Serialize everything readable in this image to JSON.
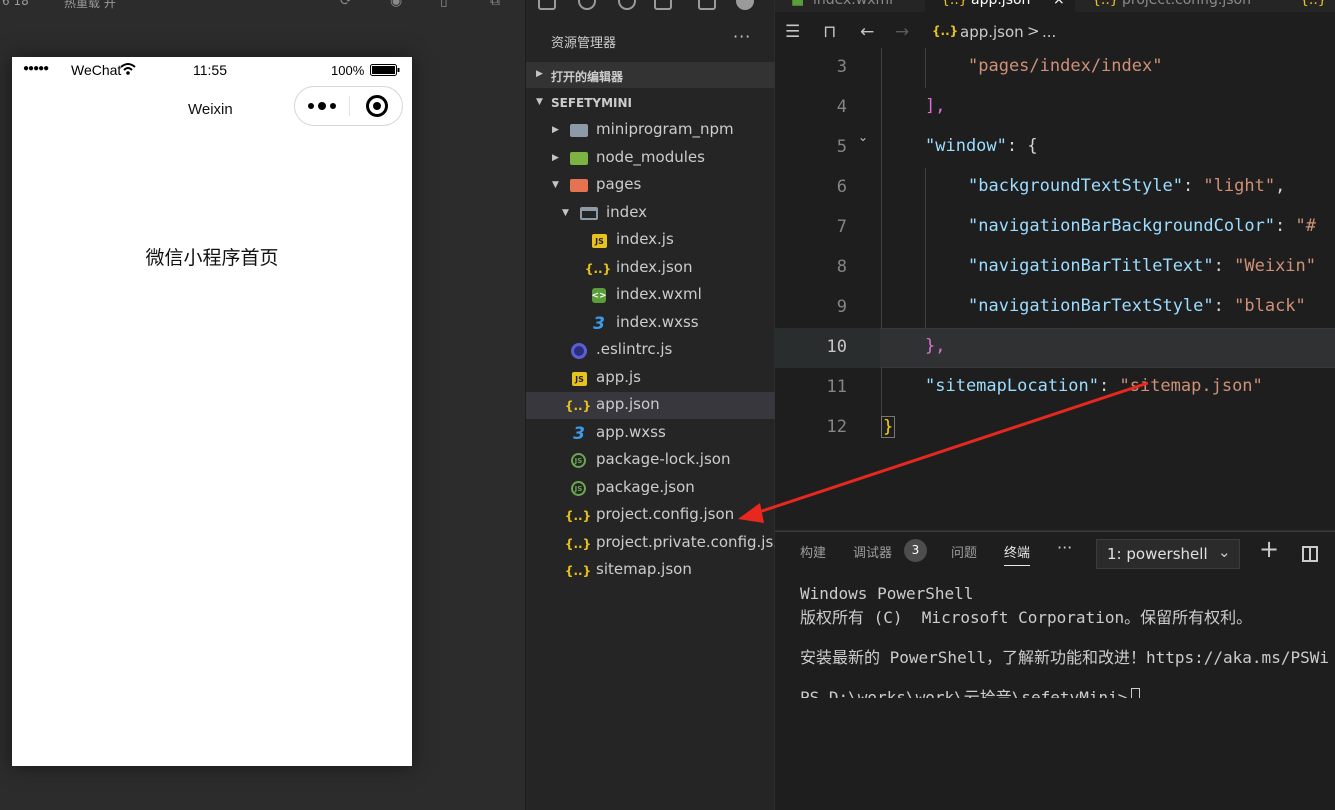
{
  "simulator": {
    "top_label_device": "6 18",
    "top_label_mode": "热重载 开",
    "status": {
      "carrier": "WeChat",
      "time": "11:55",
      "battery": "100%"
    },
    "nav_title": "Weixin",
    "page_heading": "微信小程序首页"
  },
  "explorer": {
    "title": "资源管理器",
    "more": "···",
    "section_open_editors": "打开的编辑器",
    "section_project": "SEFETYMINI",
    "tree": [
      {
        "name": "miniprogram_npm",
        "icon": "folder-icon"
      },
      {
        "name": "node_modules",
        "icon": "node-folder-icon"
      },
      {
        "name": "pages",
        "icon": "pages-folder-icon"
      },
      {
        "name": "index",
        "icon": "folder-open-icon"
      },
      {
        "name": "index.js",
        "icon": "js-file-icon",
        "badge": "JS"
      },
      {
        "name": "index.json",
        "icon": "json-file-icon",
        "badge": "{..}"
      },
      {
        "name": "index.wxml",
        "icon": "wxml-file-icon",
        "badge": "<>"
      },
      {
        "name": "index.wxss",
        "icon": "wxss-file-icon",
        "badge": "3"
      },
      {
        "name": ".eslintrc.js",
        "icon": "eslint-icon"
      },
      {
        "name": "app.js",
        "icon": "js-file-icon",
        "badge": "JS"
      },
      {
        "name": "app.json",
        "icon": "json-file-icon",
        "badge": "{..}"
      },
      {
        "name": "app.wxss",
        "icon": "wxss-file-icon",
        "badge": "3"
      },
      {
        "name": "package-lock.json",
        "icon": "node-file-icon",
        "badge": "JS"
      },
      {
        "name": "package.json",
        "icon": "node-file-icon",
        "badge": "JS"
      },
      {
        "name": "project.config.json",
        "icon": "json-file-icon",
        "badge": "{..}"
      },
      {
        "name": "project.private.config.js...",
        "icon": "json-file-icon",
        "badge": "{..}"
      },
      {
        "name": "sitemap.json",
        "icon": "json-file-icon",
        "badge": "{..}"
      }
    ]
  },
  "editor": {
    "tabs": [
      "index.wxml",
      "app.json",
      "project.config.json"
    ],
    "close_glyph": "×",
    "breadcrumb": {
      "icon": "{..}",
      "file": "app.json",
      "sep": ">",
      "more": "..."
    },
    "lines": [
      {
        "n": "3",
        "key": "",
        "val": "\"pages/index/index\""
      },
      {
        "n": "4",
        "text": "],"
      },
      {
        "n": "5",
        "key": "\"window\"",
        "text": ": {"
      },
      {
        "n": "6",
        "key": "\"backgroundTextStyle\"",
        "val": "\"light\"",
        "tail": ","
      },
      {
        "n": "7",
        "key": "\"navigationBarBackgroundColor\"",
        "val": "\"#",
        "tail": ""
      },
      {
        "n": "8",
        "key": "\"navigationBarTitleText\"",
        "val": "\"Weixin\"",
        "tail": ""
      },
      {
        "n": "9",
        "key": "\"navigationBarTextStyle\"",
        "val": "\"black\"",
        "tail": ""
      },
      {
        "n": "10",
        "text": "},"
      },
      {
        "n": "11",
        "key": "\"sitemapLocation\"",
        "val": "\"sitemap.json\"",
        "tail": ""
      },
      {
        "n": "12",
        "text": "}"
      }
    ]
  },
  "terminal": {
    "tabs": {
      "build": "构建",
      "debugger": "调试器",
      "debugger_badge": "3",
      "problems": "问题",
      "terminal": "终端"
    },
    "more": "···",
    "shell": "1: powershell",
    "plus": "+",
    "lines": [
      "Windows PowerShell",
      "版权所有 (C)  Microsoft Corporation。保留所有权利。",
      "",
      "安装最新的 PowerShell，了解新功能和改进！https://aka.ms/PSWi",
      "",
      "PS D:\\works\\work\\云拾音\\sefetyMini>"
    ]
  },
  "colors": {
    "annotation_arrow": "#e8271f",
    "json_key": "#9cdcfe",
    "json_string": "#ce9178"
  }
}
